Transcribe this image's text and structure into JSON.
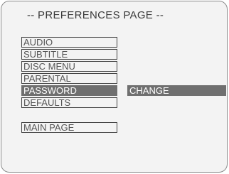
{
  "header": {
    "title": "-- PREFERENCES PAGE --"
  },
  "menu": {
    "items": [
      {
        "label": "AUDIO"
      },
      {
        "label": "SUBTITLE"
      },
      {
        "label": "DISC MENU"
      },
      {
        "label": "PARENTAL"
      },
      {
        "label": "PASSWORD",
        "selected": true
      },
      {
        "label": "DEFAULTS"
      }
    ],
    "main_page_label": "MAIN PAGE"
  },
  "submenu": {
    "items": [
      {
        "label": "CHANGE",
        "highlighted": true
      }
    ]
  },
  "colors": {
    "highlight": "#6f6f6f",
    "background": "#f3f3f3",
    "text": "#555555",
    "border": "#444444"
  }
}
